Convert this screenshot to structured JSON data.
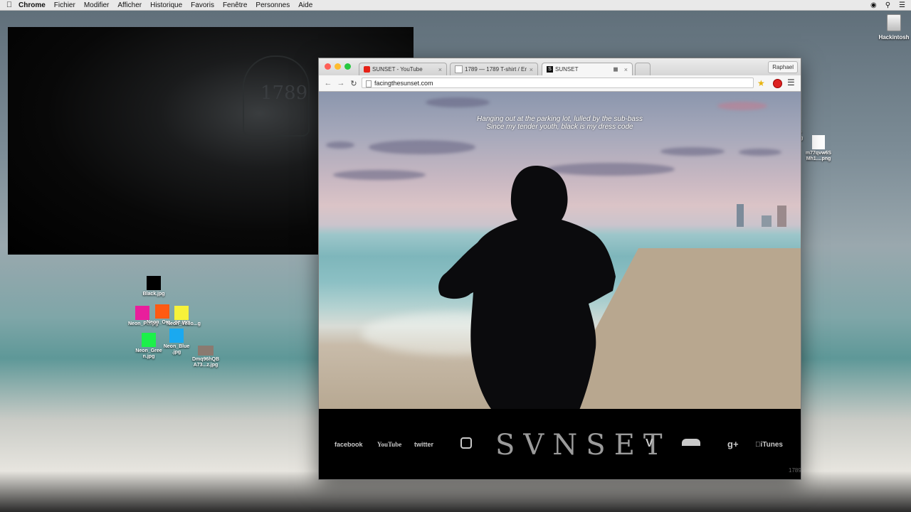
{
  "menubar": {
    "app_name": "Chrome",
    "menus": [
      "Fichier",
      "Modifier",
      "Afficher",
      "Historique",
      "Favoris",
      "Fenêtre",
      "Personnes",
      "Aide"
    ]
  },
  "desktop": {
    "hd_label": "Hackintosh",
    "icons": [
      {
        "label": "Black.jpg",
        "color": "#000000"
      },
      {
        "label": "Neon_Pi...pg",
        "color": "#e91e9c"
      },
      {
        "label": "Neon_Ora...ge.jpg",
        "color": "#ff5a12"
      },
      {
        "label": "Neon_Yello...g",
        "color": "#f7f23a"
      },
      {
        "label": "Neon_Gree n.jpg",
        "color": "#1cf04a"
      },
      {
        "label": "Neon_Blue .jpg",
        "color": "#1aa9f0"
      },
      {
        "label": "Dmq96hQB A73...z.jpg",
        "color": "#8a7a70"
      },
      {
        "label": "m77qvw6S Mh1....png",
        "color": "#f4cf2e"
      }
    ],
    "partial_label": "D pg"
  },
  "video": {
    "overlay_text": "1789"
  },
  "browser": {
    "tabs": [
      {
        "title": "SUNSET - YouTube",
        "favicon_color": "#e62117"
      },
      {
        "title": "1789 — 1789 T-shirt / Emb",
        "favicon_color": "#dddddd"
      },
      {
        "title": "SUNSET",
        "favicon_color": "#111111"
      }
    ],
    "profile": "Raphael",
    "url": "facingthesunset.com"
  },
  "page": {
    "lyrics_line1": "Hanging out at the parking lot, lulled by the sub-bass",
    "lyrics_line2": "Since my tender youth, black is my dress code",
    "logo": "SVNSET",
    "social": {
      "facebook": "facebook",
      "youtube": "YouTube",
      "twitter": "twitter",
      "vine": "V",
      "googleplus": "g+",
      "itunes": "iTunes"
    },
    "corner_mark": "1789"
  },
  "colors": {
    "accent_star": "#e8b410",
    "close_red": "#ff5f57",
    "min_yellow": "#febc2e",
    "max_green": "#28c840"
  }
}
